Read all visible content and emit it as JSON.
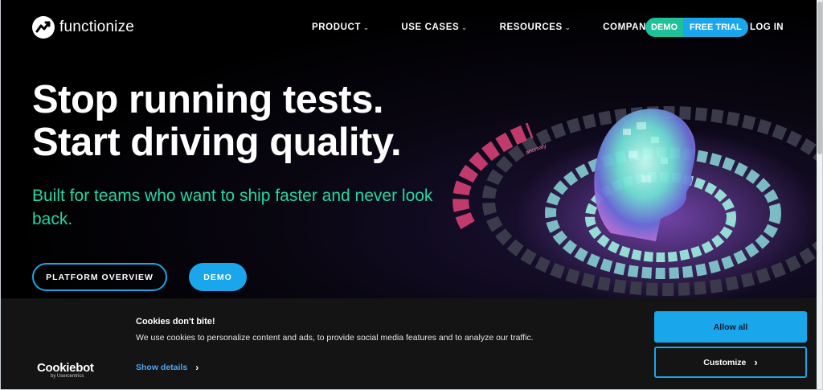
{
  "brand": {
    "name": "functionize"
  },
  "nav": {
    "items": [
      {
        "label": "PRODUCT"
      },
      {
        "label": "USE CASES"
      },
      {
        "label": "RESOURCES"
      },
      {
        "label": "COMPANY"
      }
    ],
    "cta_demo": "DEMO",
    "cta_trial": "FREE TRIAL",
    "login": "LOG IN"
  },
  "hero": {
    "headline_line1": "Stop running tests.",
    "headline_line2": "Start driving quality.",
    "subheadline": "Built for teams who want to ship faster and never look back.",
    "btn_overview": "PLATFORM OVERVIEW",
    "btn_demo": "DEMO",
    "illustration_tag": "anomaly"
  },
  "cookie": {
    "title": "Cookies don't bite!",
    "text": "We use cookies to personalize content and ads, to provide social media features and to analyze our traffic.",
    "show_details": "Show details",
    "allow_all": "Allow all",
    "customize": "Customize",
    "provider_logo": "Cookiebot",
    "provider_sub": "by Usercentrics"
  },
  "colors": {
    "accent_blue": "#1aa6ea",
    "accent_green": "#1fc199",
    "subhead_green": "#23d8a4"
  }
}
